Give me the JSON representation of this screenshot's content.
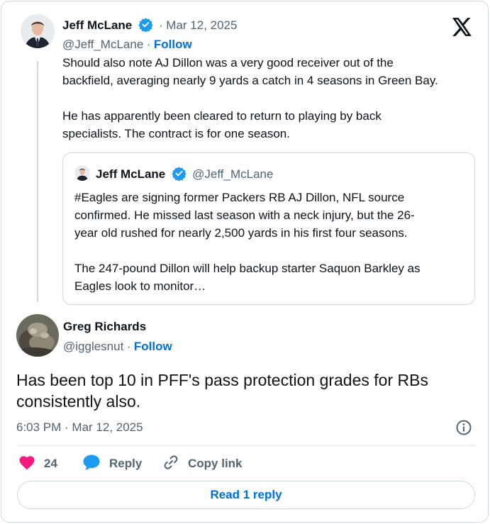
{
  "parent_tweet": {
    "author_name": "Jeff McLane",
    "date": "Mar 12, 2025",
    "handle": "@Jeff_McLane",
    "follow_label": "Follow",
    "text_line1": "Should also note AJ Dillon was a very good receiver out of the",
    "text_line2": "backfield, averaging nearly 9 yards a catch in 4 seasons in Green Bay.",
    "text_line3": "He has apparently been cleared to return to playing by back",
    "text_line4": "specialists. The contract is for one season."
  },
  "quoted_tweet": {
    "author_name": "Jeff McLane",
    "handle": "@Jeff_McLane",
    "text_line1": "#Eagles are signing former Packers RB AJ Dillon, NFL source",
    "text_line2": "confirmed. He missed last season with a neck injury, but the 26-",
    "text_line3": "year old rushed for nearly 2,500 yards in his first four seasons.",
    "text_line4": "The 247-pound Dillon will help backup starter Saquon Barkley as",
    "text_line5": "Eagles look to monitor…"
  },
  "main_tweet": {
    "author_name": "Greg Richards",
    "handle": "@igglesnut",
    "follow_label": "Follow",
    "text_line1": "Has been top 10 in PFF's pass protection grades for RBs",
    "text_line2": "consistently also.",
    "timestamp": "6:03 PM · Mar 12, 2025"
  },
  "actions": {
    "like_count": "24",
    "reply_label": "Reply",
    "copy_link_label": "Copy link",
    "read_replies_label": "Read 1 reply"
  },
  "colors": {
    "accent": "#006fd6",
    "like": "#f91880",
    "reply": "#1d9bf0",
    "verified": "#1d9bf0"
  },
  "icons": {
    "brand": "x-logo-icon",
    "verified": "verified-badge-icon",
    "like": "heart-icon",
    "reply": "speech-bubble-icon",
    "copy": "link-icon",
    "info": "info-icon"
  }
}
